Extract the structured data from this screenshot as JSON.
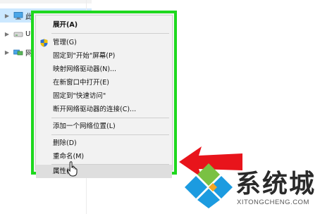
{
  "nav": {
    "items": [
      {
        "label": "此电脑",
        "icon": "computer-icon",
        "selected": true
      },
      {
        "label": "USB",
        "icon": "usb-drive-icon",
        "selected": false
      },
      {
        "label": "网络",
        "icon": "network-icon",
        "selected": false
      }
    ]
  },
  "menu": {
    "highlight_color": "#1ed81e",
    "items": [
      {
        "label": "展开(A)",
        "bold": true
      },
      {
        "label": "管理(G)",
        "icon": "admin-shield-icon"
      },
      {
        "label": "固定到\"开始\"屏幕(P)"
      },
      {
        "label": "映射网络驱动器(N)..."
      },
      {
        "label": "在新窗口中打开(E)"
      },
      {
        "label": "固定到\"快速访问\""
      },
      {
        "label": "断开网络驱动器的连接(C)..."
      },
      {
        "label": "添加一个网络位置(L)"
      },
      {
        "label": "删除(D)"
      },
      {
        "label": "重命名(M)"
      },
      {
        "label": "属性(R)",
        "hover": true
      }
    ]
  },
  "annotation": {
    "arrow_color": "#e8141b",
    "icon": "pointer-arrow-icon"
  },
  "watermark": {
    "brand_cn": "系统城",
    "url": "XITONGCHENG.COM",
    "colors": {
      "blue": "#1c9be0",
      "green": "#7ac143",
      "orange": "#f5a623"
    }
  }
}
